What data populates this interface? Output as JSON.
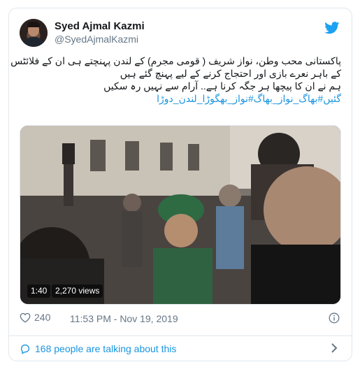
{
  "author": {
    "name": "Syed Ajmal Kazmi",
    "handle": "@SyedAjmalKazmi"
  },
  "tweet": {
    "lines": [
      "پاکستانی محب وطن، نواز شریف ( قومی مجرم) کے لندن پہنچتے ہی ان کے فلائٹس",
      "کے باہر نعرے بازی اور احتجاج کرنے کے لیے پہنچ گئے ہیں",
      "ہم نے ان کا پیچھا ہر جگہ کرنا ہے.. آرام سے نہیں رہ سکیں",
      "گئیں#بھاگ_نواز_بھاگ#نواز_بھگوڑا_لندن_دوڑا"
    ]
  },
  "media": {
    "duration": "1:40",
    "views": "2,270 views"
  },
  "meta": {
    "likes": "240",
    "timestamp": "11:53 PM - Nov 19, 2019"
  },
  "footer": {
    "talking": "168 people are talking about this"
  },
  "colors": {
    "link": "#1b95e0",
    "secondary_text": "#657786",
    "border": "#e1e8ed"
  }
}
